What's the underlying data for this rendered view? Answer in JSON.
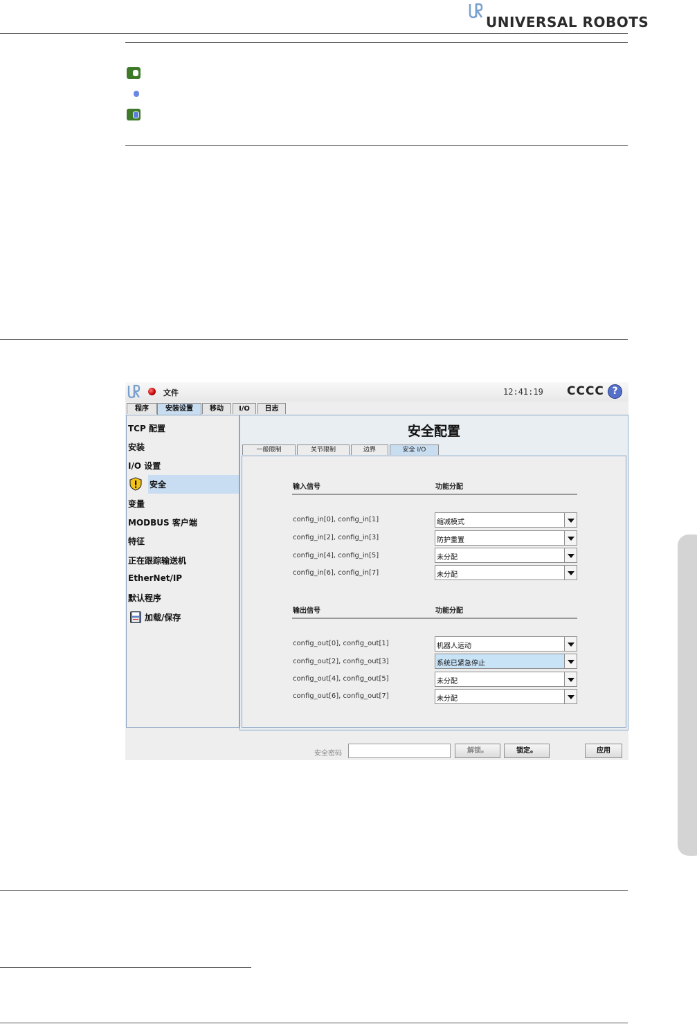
{
  "header": {
    "brand": "UNIVERSAL ROBOTS"
  },
  "screen": {
    "topbar": {
      "file_label": "文件",
      "time": "12:41:19",
      "robot_name": "CCCC",
      "help": "?"
    },
    "main_tabs": [
      "程序",
      "安装设置",
      "移动",
      "I/O",
      "日志"
    ],
    "sidebar": {
      "items": [
        "TCP 配置",
        "安装",
        "I/O 设置",
        "安全",
        "变量",
        "MODBUS 客户端",
        "特征",
        "正在跟踪输送机",
        "EtherNet/IP",
        "默认程序",
        "加载/保存"
      ],
      "selected": "安全"
    },
    "title": "安全配置",
    "sub_tabs": [
      "一般限制",
      "关节限制",
      "边界",
      "安全 I/O"
    ],
    "inputs": {
      "header_signal": "输入信号",
      "header_function": "功能分配",
      "rows": [
        {
          "signal": "config_in[0], config_in[1]",
          "function": "缩减模式"
        },
        {
          "signal": "config_in[2], config_in[3]",
          "function": "防护重置"
        },
        {
          "signal": "config_in[4], config_in[5]",
          "function": "未分配"
        },
        {
          "signal": "config_in[6], config_in[7]",
          "function": "未分配"
        }
      ]
    },
    "outputs": {
      "header_signal": "输出信号",
      "header_function": "功能分配",
      "rows": [
        {
          "signal": "config_out[0], config_out[1]",
          "function": "机器人运动"
        },
        {
          "signal": "config_out[2], config_out[3]",
          "function": "系统已紧急停止"
        },
        {
          "signal": "config_out[4], config_out[5]",
          "function": "未分配"
        },
        {
          "signal": "config_out[6], config_out[7]",
          "function": "未分配"
        }
      ]
    },
    "bottom": {
      "password_label": "安全密码",
      "password_value": "",
      "unlock": "解锁。",
      "lock": "锁定。",
      "apply": "应用"
    }
  },
  "colors": {
    "led_green": "#3f7a2a",
    "selection": "#c8dcf2",
    "highlight_dropdown": "#c8e2f6"
  }
}
